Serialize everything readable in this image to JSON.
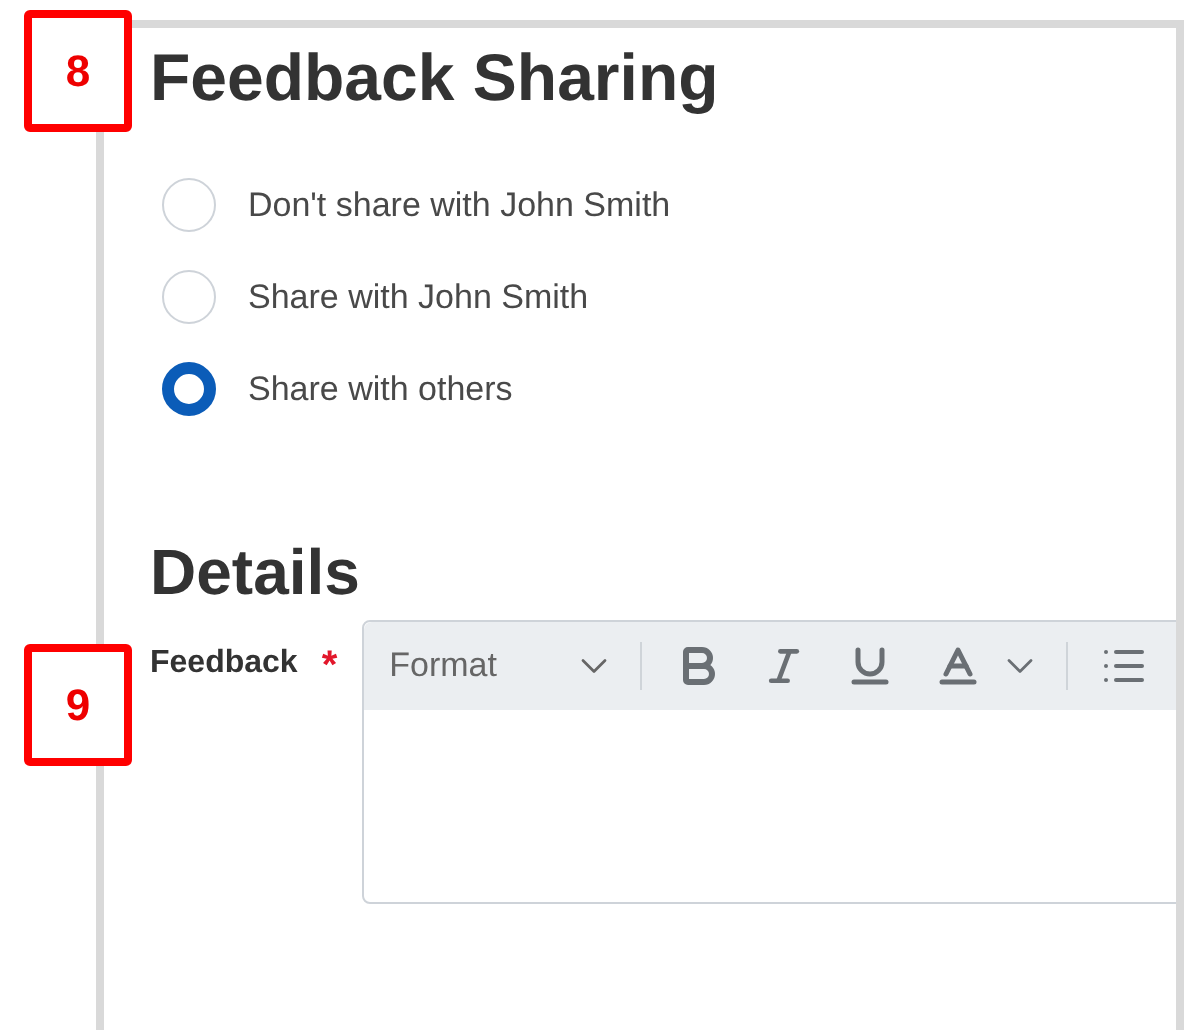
{
  "sharing": {
    "callout": "8",
    "title": "Feedback Sharing",
    "options": [
      {
        "label": "Don't share with John Smith",
        "selected": false
      },
      {
        "label": "Share with John Smith",
        "selected": false
      },
      {
        "label": "Share with others",
        "selected": true
      }
    ]
  },
  "details": {
    "title": "Details",
    "field": {
      "callout": "9",
      "label": "Feedback",
      "required_mark": "*",
      "format_placeholder": "Format"
    }
  }
}
